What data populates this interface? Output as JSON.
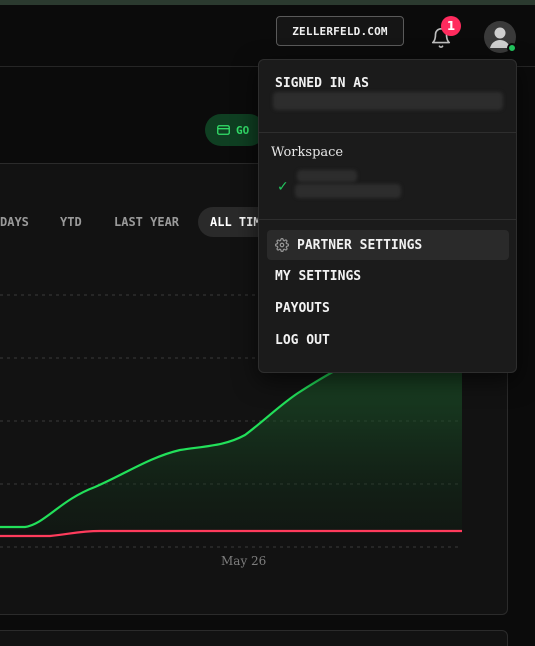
{
  "header": {
    "domain_button": "ZELLERFELD.COM",
    "notification_count": "1"
  },
  "go_pill": {
    "label": "GO"
  },
  "filters": [
    {
      "label": "DAYS"
    },
    {
      "label": "YTD"
    },
    {
      "label": "LAST YEAR"
    },
    {
      "label": "ALL TIM"
    }
  ],
  "chart": {
    "x_label": "May 26",
    "line_colors": {
      "primary": "#22e05a",
      "secondary": "#ff3b5c"
    }
  },
  "user_menu": {
    "signed_in_heading": "SIGNED IN AS",
    "workspace_heading": "Workspace",
    "items": [
      {
        "label": "PARTNER SETTINGS",
        "icon": "gear-icon"
      },
      {
        "label": "MY SETTINGS"
      },
      {
        "label": "PAYOUTS"
      },
      {
        "label": "LOG OUT"
      }
    ]
  }
}
